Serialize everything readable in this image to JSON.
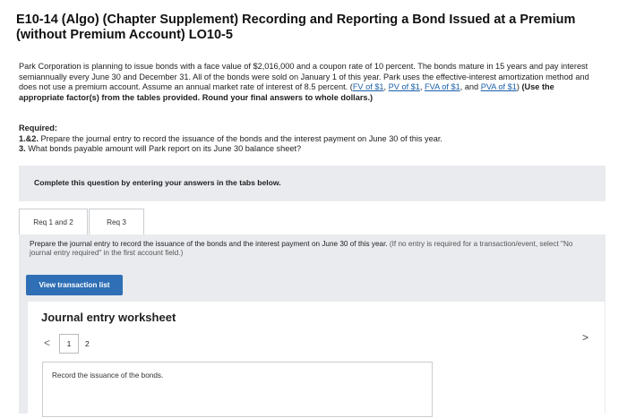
{
  "title": "E10-14 (Algo) (Chapter Supplement) Recording and Reporting a Bond Issued at a Premium (without Premium Account) LO10-5",
  "intro": {
    "text_before_links": "Park Corporation is planning to issue bonds with a face value of $2,016,000 and a coupon rate of 10 percent. The bonds mature in 15 years and pay interest semiannually every June 30 and December 31. All of the bonds were sold on January 1 of this year. Park uses the effective-interest amortization method and does not use a premium account. Assume an annual market rate of interest of 8.5 percent. (",
    "links": [
      "FV of $1",
      "PV of $1",
      "FVA of $1",
      "PVA of $1"
    ],
    "sep1": ", ",
    "sep2": ", ",
    "sep3": ", and ",
    "close": ") ",
    "bold_instruction": "(Use the appropriate factor(s) from the tables provided. Round your final answers to whole dollars.)"
  },
  "required": {
    "heading": "Required:",
    "item1_num": "1.&2.",
    "item1_text": " Prepare the journal entry to record the issuance of the bonds and the interest payment on June 30 of this year.",
    "item2_num": "3.",
    "item2_text": " What bonds payable amount will Park report on its June 30 balance sheet?"
  },
  "complete_notice": "Complete this question by entering your answers in the tabs below.",
  "tabs": [
    {
      "label": "Req 1 and 2"
    },
    {
      "label": "Req 3"
    }
  ],
  "panel": {
    "prompt": "Prepare the journal entry to record the issuance of the bonds and the interest payment on June 30 of this year.",
    "note": "(If no entry is required for a transaction/event, select \"No journal entry required\" in the first account field.)",
    "view_button": "View transaction list"
  },
  "worksheet": {
    "title": "Journal entry worksheet",
    "prev_icon": "<",
    "next_icon": ">",
    "pages": [
      "1",
      "2"
    ],
    "instruction": "Record the issuance of the bonds."
  }
}
